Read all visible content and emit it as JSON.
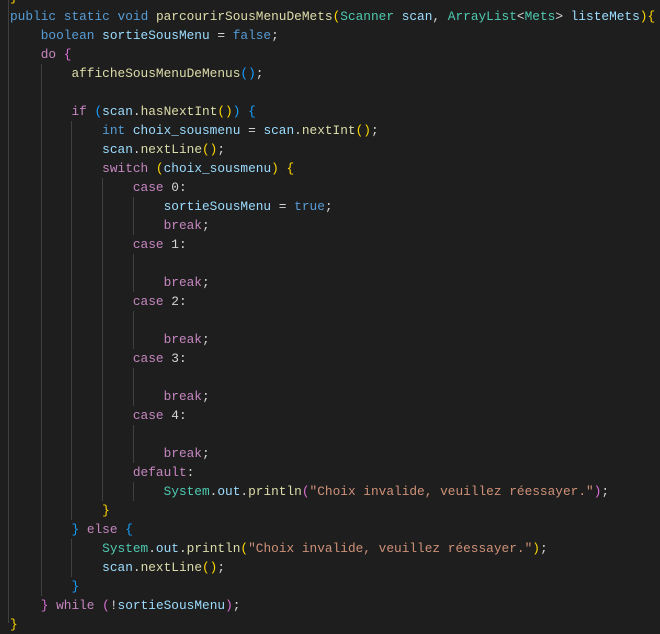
{
  "editor": {
    "language": "java",
    "lines": [
      {
        "indent": 0,
        "tokens": [
          [
            "b1",
            "}"
          ]
        ]
      },
      {
        "indent": 0,
        "tokens": [
          [
            "kw",
            "public "
          ],
          [
            "kw",
            "static "
          ],
          [
            "kw",
            "void "
          ],
          [
            "fn",
            "parcourirSousMenuDeMets"
          ],
          [
            "b1",
            "("
          ],
          [
            "ty",
            "Scanner "
          ],
          [
            "var",
            "scan"
          ],
          [
            "pl",
            ", "
          ],
          [
            "ty",
            "ArrayList"
          ],
          [
            "pl",
            "<"
          ],
          [
            "ty",
            "Mets"
          ],
          [
            "pl",
            "> "
          ],
          [
            "var",
            "listeMets"
          ],
          [
            "b1",
            ")"
          ],
          [
            "b1",
            "{"
          ]
        ]
      },
      {
        "indent": 1,
        "tokens": [
          [
            "kw",
            "boolean "
          ],
          [
            "var",
            "sortieSousMenu"
          ],
          [
            "pl",
            " = "
          ],
          [
            "kw",
            "false"
          ],
          [
            "pl",
            ";"
          ]
        ]
      },
      {
        "indent": 1,
        "tokens": [
          [
            "ctl",
            "do "
          ],
          [
            "b2",
            "{"
          ]
        ]
      },
      {
        "indent": 2,
        "tokens": [
          [
            "fn",
            "afficheSousMenuDeMenus"
          ],
          [
            "b3",
            "()"
          ],
          [
            "pl",
            ";"
          ]
        ]
      },
      {
        "indent": 2,
        "tokens": []
      },
      {
        "indent": 2,
        "tokens": [
          [
            "ctl",
            "if "
          ],
          [
            "b3",
            "("
          ],
          [
            "var",
            "scan"
          ],
          [
            "pl",
            "."
          ],
          [
            "fn",
            "hasNextInt"
          ],
          [
            "b1",
            "()"
          ],
          [
            "b3",
            ")"
          ],
          [
            "pl",
            " "
          ],
          [
            "b3",
            "{"
          ]
        ]
      },
      {
        "indent": 3,
        "tokens": [
          [
            "kw",
            "int "
          ],
          [
            "var",
            "choix_sousmenu"
          ],
          [
            "pl",
            " = "
          ],
          [
            "var",
            "scan"
          ],
          [
            "pl",
            "."
          ],
          [
            "fn",
            "nextInt"
          ],
          [
            "b1",
            "()"
          ],
          [
            "pl",
            ";"
          ]
        ]
      },
      {
        "indent": 3,
        "tokens": [
          [
            "var",
            "scan"
          ],
          [
            "pl",
            "."
          ],
          [
            "fn",
            "nextLine"
          ],
          [
            "b1",
            "()"
          ],
          [
            "pl",
            ";"
          ]
        ]
      },
      {
        "indent": 3,
        "tokens": [
          [
            "ctl",
            "switch "
          ],
          [
            "b1",
            "("
          ],
          [
            "var",
            "choix_sousmenu"
          ],
          [
            "b1",
            ")"
          ],
          [
            "pl",
            " "
          ],
          [
            "b1",
            "{"
          ]
        ]
      },
      {
        "indent": 4,
        "tokens": [
          [
            "ctl",
            "case "
          ],
          [
            "pl",
            "0:"
          ]
        ]
      },
      {
        "indent": 5,
        "tokens": [
          [
            "var",
            "sortieSousMenu"
          ],
          [
            "pl",
            " = "
          ],
          [
            "kw",
            "true"
          ],
          [
            "pl",
            ";"
          ]
        ]
      },
      {
        "indent": 5,
        "tokens": [
          [
            "ctl",
            "break"
          ],
          [
            "pl",
            ";"
          ]
        ]
      },
      {
        "indent": 4,
        "tokens": [
          [
            "ctl",
            "case "
          ],
          [
            "pl",
            "1:"
          ]
        ]
      },
      {
        "indent": 5,
        "tokens": []
      },
      {
        "indent": 5,
        "tokens": [
          [
            "ctl",
            "break"
          ],
          [
            "pl",
            ";"
          ]
        ]
      },
      {
        "indent": 4,
        "tokens": [
          [
            "ctl",
            "case "
          ],
          [
            "pl",
            "2:"
          ]
        ]
      },
      {
        "indent": 5,
        "tokens": []
      },
      {
        "indent": 5,
        "tokens": [
          [
            "ctl",
            "break"
          ],
          [
            "pl",
            ";"
          ]
        ]
      },
      {
        "indent": 4,
        "tokens": [
          [
            "ctl",
            "case "
          ],
          [
            "pl",
            "3:"
          ]
        ]
      },
      {
        "indent": 5,
        "tokens": []
      },
      {
        "indent": 5,
        "tokens": [
          [
            "ctl",
            "break"
          ],
          [
            "pl",
            ";"
          ]
        ]
      },
      {
        "indent": 4,
        "tokens": [
          [
            "ctl",
            "case "
          ],
          [
            "pl",
            "4:"
          ]
        ]
      },
      {
        "indent": 5,
        "tokens": []
      },
      {
        "indent": 5,
        "tokens": [
          [
            "ctl",
            "break"
          ],
          [
            "pl",
            ";"
          ]
        ]
      },
      {
        "indent": 4,
        "tokens": [
          [
            "ctl",
            "default"
          ],
          [
            "pl",
            ":"
          ]
        ]
      },
      {
        "indent": 5,
        "tokens": [
          [
            "ty",
            "System"
          ],
          [
            "pl",
            "."
          ],
          [
            "var",
            "out"
          ],
          [
            "pl",
            "."
          ],
          [
            "fn",
            "println"
          ],
          [
            "b2",
            "("
          ],
          [
            "str",
            "\"Choix invalide, veuillez réessayer.\""
          ],
          [
            "b2",
            ")"
          ],
          [
            "pl",
            ";"
          ]
        ]
      },
      {
        "indent": 3,
        "tokens": [
          [
            "b1",
            "}"
          ]
        ]
      },
      {
        "indent": 2,
        "tokens": [
          [
            "b3",
            "}"
          ],
          [
            "pl",
            " "
          ],
          [
            "ctl",
            "else "
          ],
          [
            "b3",
            "{"
          ]
        ]
      },
      {
        "indent": 3,
        "tokens": [
          [
            "ty",
            "System"
          ],
          [
            "pl",
            "."
          ],
          [
            "var",
            "out"
          ],
          [
            "pl",
            "."
          ],
          [
            "fn",
            "println"
          ],
          [
            "b1",
            "("
          ],
          [
            "str",
            "\"Choix invalide, veuillez réessayer.\""
          ],
          [
            "b1",
            ")"
          ],
          [
            "pl",
            ";"
          ]
        ]
      },
      {
        "indent": 3,
        "tokens": [
          [
            "var",
            "scan"
          ],
          [
            "pl",
            "."
          ],
          [
            "fn",
            "nextLine"
          ],
          [
            "b1",
            "()"
          ],
          [
            "pl",
            ";"
          ]
        ]
      },
      {
        "indent": 2,
        "tokens": [
          [
            "b3",
            "}"
          ]
        ]
      },
      {
        "indent": 1,
        "tokens": [
          [
            "b2",
            "}"
          ],
          [
            "pl",
            " "
          ],
          [
            "ctl",
            "while "
          ],
          [
            "b2",
            "("
          ],
          [
            "pl",
            "!"
          ],
          [
            "var",
            "sortieSousMenu"
          ],
          [
            "b2",
            ")"
          ],
          [
            "pl",
            ";"
          ]
        ]
      },
      {
        "indent": 0,
        "tokens": [
          [
            "b1",
            "}"
          ]
        ]
      }
    ]
  }
}
